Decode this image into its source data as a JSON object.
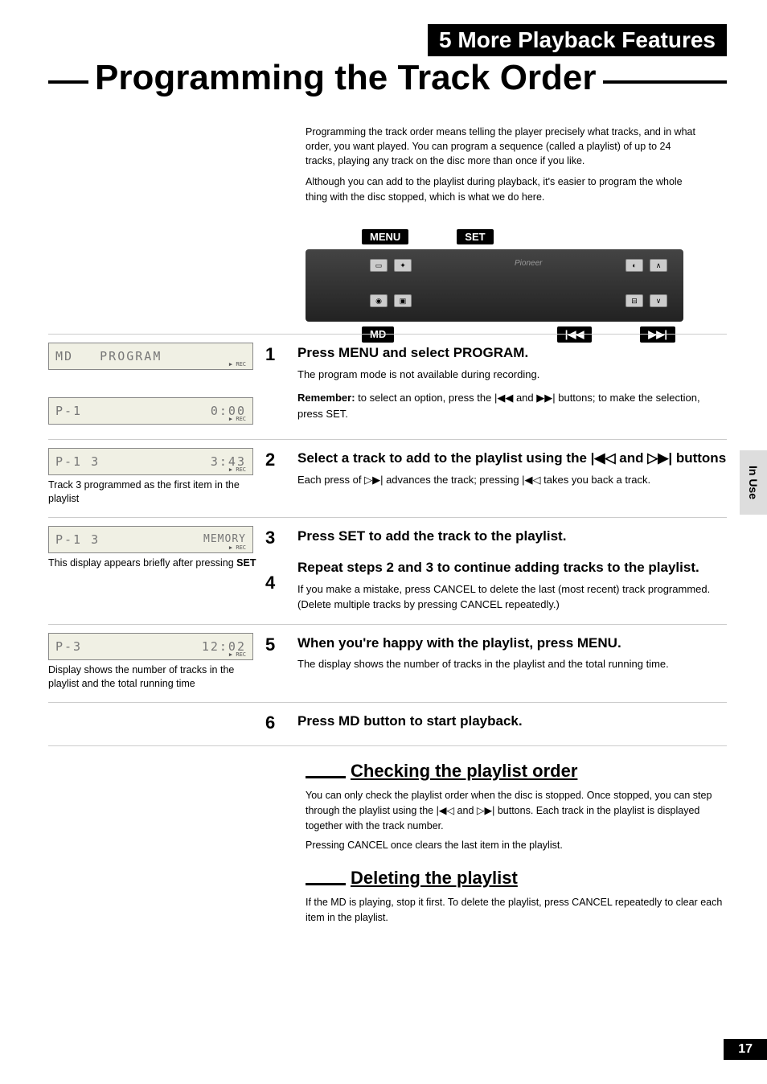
{
  "chapter_label": "5  More Playback Features",
  "title": "Programming the Track Order",
  "intro": {
    "p1": "Programming the track order means telling the player precisely what tracks, and in what order, you want played. You can program a sequence (called a playlist) of up to 24 tracks, playing any track on the disc more than once if you like.",
    "p2": "Although you can add to the playlist during playback, it's easier to program the whole thing with the disc stopped, which is what we do here."
  },
  "remote": {
    "menu": "MENU",
    "set": "SET",
    "md": "MD",
    "brand": "Pioneer",
    "prev_icon": "|◀◀",
    "next_icon": "▶▶|"
  },
  "steps": [
    {
      "num": "1",
      "lcd": {
        "left": "MD",
        "center": "PROGRAM",
        "dot": "▶ REC"
      },
      "title": "Press MENU and select PROGRAM.",
      "body": "The program mode is not available during recording.",
      "body2_pre": "Remember:",
      "body2": " to select an option, press the |◀◀ and ▶▶| buttons; to make the selection, press SET.",
      "lcd2": {
        "left": "P-1",
        "right": "0:00",
        "dot": "▶ REC"
      }
    },
    {
      "num": "2",
      "lcd": {
        "left": "P-1    3",
        "right": "3:43",
        "dot": "▶ REC"
      },
      "lcap": "Track 3 programmed as the first item in the playlist",
      "title": "Select a track to add to the playlist using the |◀◁ and ▷▶| buttons",
      "body": "Each press of ▷▶| advances the track; pressing |◀◁ takes you back a track."
    },
    {
      "num": "3",
      "lcd": {
        "left": "P-1    3",
        "right": "MEMORY",
        "dot": "▶ REC"
      },
      "lcap_pre": "This display appears briefly after pressing ",
      "lcap_b": "SET",
      "title": "Press SET to add the track to the playlist."
    },
    {
      "num": "4",
      "title": "Repeat steps 2 and 3 to continue adding tracks to the playlist.",
      "body": "If you make a mistake, press CANCEL to delete the last (most recent) track programmed. (Delete multiple tracks by pressing CANCEL repeatedly.)"
    },
    {
      "num": "5",
      "lcd": {
        "left": "P-3",
        "right": "12:02",
        "dot": "▶ REC"
      },
      "lcap": "Display shows the number of tracks in the playlist and the total running time",
      "title": "When you're happy with the playlist, press MENU.",
      "body": "The display shows the number of tracks in the playlist and the total running time."
    },
    {
      "num": "6",
      "title": "Press MD button to start playback."
    }
  ],
  "sub1": {
    "heading": "Checking the playlist order",
    "p1": "You can only check the playlist order when the disc is stopped. Once stopped, you can step through the playlist using the |◀◁ and ▷▶| buttons. Each track in the playlist is displayed together with the track number.",
    "p2": "Pressing CANCEL once clears the last item in the playlist."
  },
  "sub2": {
    "heading": "Deleting the playlist",
    "p1": "If the MD is playing, stop it first. To delete the playlist, press CANCEL repeatedly to clear each item in the playlist."
  },
  "side_tab": "In Use",
  "page_number": "17"
}
